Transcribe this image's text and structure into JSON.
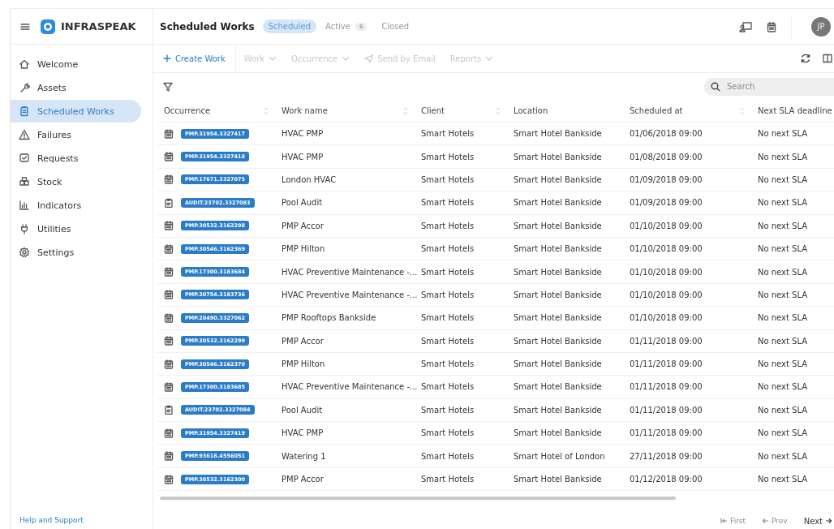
{
  "app": {
    "brand": "INFRASPEAK"
  },
  "sidebar": {
    "items": [
      {
        "label": "Welcome",
        "selected": false
      },
      {
        "label": "Assets",
        "selected": false
      },
      {
        "label": "Scheduled Works",
        "selected": true
      },
      {
        "label": "Failures",
        "selected": false
      },
      {
        "label": "Requests",
        "selected": false
      },
      {
        "label": "Stock",
        "selected": false
      },
      {
        "label": "Indicators",
        "selected": false
      },
      {
        "label": "Utilities",
        "selected": false
      },
      {
        "label": "Settings",
        "selected": false
      }
    ],
    "footer_link": "Help and Support"
  },
  "header": {
    "title": "Scheduled Works",
    "tabs": [
      {
        "label": "Scheduled",
        "selected": true
      },
      {
        "label": "Active",
        "count": "6",
        "selected": false
      },
      {
        "label": "Closed",
        "selected": false
      }
    ],
    "avatar": "JP"
  },
  "toolbar": {
    "actions": [
      {
        "label": "Create Work",
        "kind": "create",
        "disabled": false
      },
      {
        "label": "Work",
        "kind": "menu",
        "disabled": true
      },
      {
        "label": "Occurrence",
        "kind": "menu",
        "disabled": true
      },
      {
        "label": "Send by Email",
        "kind": "send",
        "disabled": true
      },
      {
        "label": "Reports",
        "kind": "menu",
        "disabled": true
      }
    ]
  },
  "search": {
    "placeholder": "Search"
  },
  "table": {
    "columns": [
      {
        "label": "Occurrence",
        "sortable": true
      },
      {
        "label": "Work name",
        "sortable": true
      },
      {
        "label": "Client",
        "sortable": true
      },
      {
        "label": "Location",
        "sortable": false
      },
      {
        "label": "Scheduled at",
        "sortable": true
      },
      {
        "label": "Next SLA deadline"
      }
    ],
    "rows": [
      {
        "kind": "calendar",
        "occurrence": "PMP.31954.3327417",
        "work": "HVAC PMP",
        "client": "Smart Hotels",
        "location": "Smart Hotel Bankside",
        "scheduled": "01/06/2018 09:00",
        "sla": "No next SLA"
      },
      {
        "kind": "calendar",
        "occurrence": "PMP.31954.3327418",
        "work": "HVAC PMP",
        "client": "Smart Hotels",
        "location": "Smart Hotel Bankside",
        "scheduled": "01/08/2018 09:00",
        "sla": "No next SLA"
      },
      {
        "kind": "calendar",
        "occurrence": "PMP.17671.3327075",
        "work": "London HVAC",
        "client": "Smart Hotels",
        "location": "Smart Hotel Bankside",
        "scheduled": "01/09/2018 09:00",
        "sla": "No next SLA"
      },
      {
        "kind": "clipboard",
        "occurrence": "AUDIT.23702.3327083",
        "work": "Pool Audit",
        "client": "Smart Hotels",
        "location": "Smart Hotel Bankside",
        "scheduled": "01/09/2018 09:00",
        "sla": "No next SLA"
      },
      {
        "kind": "calendar",
        "occurrence": "PMP.30532.3162298",
        "work": "PMP Accor",
        "client": "Smart Hotels",
        "location": "Smart Hotel Bankside",
        "scheduled": "01/10/2018 09:00",
        "sla": "No next SLA"
      },
      {
        "kind": "calendar",
        "occurrence": "PMP.30546.3162369",
        "work": "PMP Hilton",
        "client": "Smart Hotels",
        "location": "Smart Hotel Bankside",
        "scheduled": "01/10/2018 09:00",
        "sla": "No next SLA"
      },
      {
        "kind": "calendar",
        "occurrence": "PMP.17300.3183684",
        "work": "HVAC Preventive Maintenance -...",
        "client": "Smart Hotels",
        "location": "Smart Hotel Bankside",
        "scheduled": "01/10/2018 09:00",
        "sla": "No next SLA"
      },
      {
        "kind": "calendar",
        "occurrence": "PMP.30754.3183736",
        "work": "HVAC Preventive Maintenance -...",
        "client": "Smart Hotels",
        "location": "Smart Hotel Bankside",
        "scheduled": "01/10/2018 09:00",
        "sla": "No next SLA"
      },
      {
        "kind": "calendar",
        "occurrence": "PMP.20490.3327062",
        "work": "PMP Rooftops Bankside",
        "client": "Smart Hotels",
        "location": "Smart Hotel Bankside",
        "scheduled": "01/10/2018 09:00",
        "sla": "No next SLA"
      },
      {
        "kind": "calendar",
        "occurrence": "PMP.30532.3162299",
        "work": "PMP Accor",
        "client": "Smart Hotels",
        "location": "Smart Hotel Bankside",
        "scheduled": "01/11/2018 09:00",
        "sla": "No next SLA"
      },
      {
        "kind": "calendar",
        "occurrence": "PMP.30546.3162370",
        "work": "PMP Hilton",
        "client": "Smart Hotels",
        "location": "Smart Hotel Bankside",
        "scheduled": "01/11/2018 09:00",
        "sla": "No next SLA"
      },
      {
        "kind": "calendar",
        "occurrence": "PMP.17300.3183685",
        "work": "HVAC Preventive Maintenance -...",
        "client": "Smart Hotels",
        "location": "Smart Hotel Bankside",
        "scheduled": "01/11/2018 09:00",
        "sla": "No next SLA"
      },
      {
        "kind": "clipboard",
        "occurrence": "AUDIT.23702.3327084",
        "work": "Pool Audit",
        "client": "Smart Hotels",
        "location": "Smart Hotel Bankside",
        "scheduled": "01/11/2018 09:00",
        "sla": "No next SLA"
      },
      {
        "kind": "calendar",
        "occurrence": "PMP.31954.3327419",
        "work": "HVAC PMP",
        "client": "Smart Hotels",
        "location": "Smart Hotel Bankside",
        "scheduled": "01/11/2018 09:00",
        "sla": "No next SLA"
      },
      {
        "kind": "calendar",
        "occurrence": "PMP.93618.4556051",
        "work": "Watering 1",
        "client": "Smart Hotels",
        "location": "Smart Hotel of London",
        "scheduled": "27/11/2018 09:00",
        "sla": "No next SLA"
      },
      {
        "kind": "calendar",
        "occurrence": "PMP.30532.3162300",
        "work": "PMP Accor",
        "client": "Smart Hotels",
        "location": "Smart Hotel Bankside",
        "scheduled": "01/12/2018 09:00",
        "sla": "No next SLA"
      }
    ]
  },
  "pagination": [
    {
      "label": "First",
      "kind": "first",
      "disabled": true
    },
    {
      "label": "Prev",
      "kind": "prev",
      "disabled": true
    },
    {
      "label": "Next",
      "kind": "next",
      "disabled": false
    }
  ]
}
